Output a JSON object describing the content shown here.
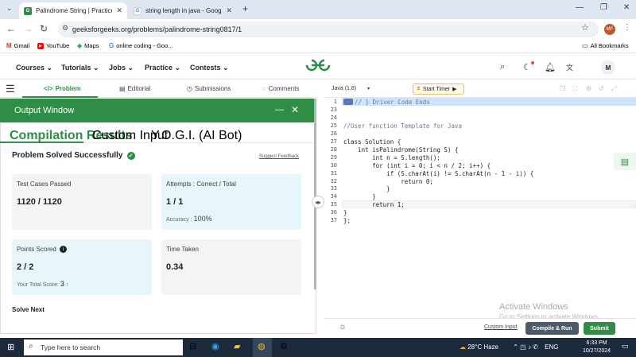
{
  "browser": {
    "tabs": [
      {
        "title": "Palindrome String | Practice | G",
        "active": true
      },
      {
        "title": "string length in java - Google S",
        "active": false
      }
    ],
    "new_tab": "+",
    "url": "geeksforgeeks.org/problems/palindrome-string0817/1",
    "profile_initials": "MF",
    "bookmarks": [
      {
        "label": "Gmail"
      },
      {
        "label": "YouTube"
      },
      {
        "label": "Maps"
      },
      {
        "label": "online coding - Goo..."
      }
    ],
    "all_bookmarks": "All Bookmarks"
  },
  "site": {
    "nav": [
      "Courses",
      "Tutorials",
      "Jobs",
      "Practice",
      "Contests"
    ],
    "avatar": "M"
  },
  "problem_tabs": {
    "problem": "Problem",
    "editorial": "Editorial",
    "submissions": "Submissions",
    "comments": "Comments"
  },
  "output": {
    "title": "Output Window",
    "tabs": [
      "Compilation Results",
      "Custom Input",
      "Y.O.G.I. (AI Bot)"
    ],
    "status": "Problem Solved Successfully",
    "suggest_feedback": "Suggest Feedback",
    "test_cases_label": "Test Cases Passed",
    "test_cases_value": "1120 / 1120",
    "attempts_label": "Attempts : Correct / Total",
    "attempts_value": "1 / 1",
    "accuracy_label": "Accuracy :",
    "accuracy_value": "100%",
    "points_label": "Points Scored",
    "points_value": "2 / 2",
    "total_score_label": "Your Total Score:",
    "total_score_value": "3",
    "time_label": "Time Taken",
    "time_value": "0.34",
    "solve_next": "Solve Next"
  },
  "editor": {
    "language": "Java (1.8)",
    "start_timer": "Start Timer",
    "lines": [
      {
        "n": "1",
        "t": "// } Driver Code Ends",
        "cls": "cm"
      },
      {
        "n": "23",
        "t": "",
        "cls": ""
      },
      {
        "n": "24",
        "t": "",
        "cls": ""
      },
      {
        "n": "25",
        "t": "//User function Template for Java",
        "cls": "cm"
      },
      {
        "n": "26",
        "t": "",
        "cls": ""
      },
      {
        "n": "27",
        "t": "class Solution {",
        "cls": ""
      },
      {
        "n": "28",
        "t": "    int isPalindrome(String S) {",
        "cls": ""
      },
      {
        "n": "29",
        "t": "        int n = S.length();",
        "cls": ""
      },
      {
        "n": "30",
        "t": "        for (int i = 0; i < n / 2; i++) {",
        "cls": ""
      },
      {
        "n": "31",
        "t": "            if (S.charAt(i) != S.charAt(n - 1 - i)) {",
        "cls": ""
      },
      {
        "n": "32",
        "t": "                return 0;",
        "cls": ""
      },
      {
        "n": "33",
        "t": "            }",
        "cls": ""
      },
      {
        "n": "34",
        "t": "        }",
        "cls": ""
      },
      {
        "n": "35",
        "t": "        return 1;",
        "cls": ""
      },
      {
        "n": "36",
        "t": "}",
        "cls": ""
      },
      {
        "n": "37",
        "t": "};",
        "cls": ""
      }
    ],
    "custom_input": "Custom Input",
    "compile_run": "Compile & Run",
    "submit": "Submit"
  },
  "watermark": {
    "line1": "Activate Windows",
    "line2": "Go to Settings to activate Windows."
  },
  "taskbar": {
    "search_placeholder": "Type here to search",
    "weather": "28°C  Haze",
    "lang": "ENG",
    "time": "6:33 PM",
    "date": "10/27/2024"
  }
}
